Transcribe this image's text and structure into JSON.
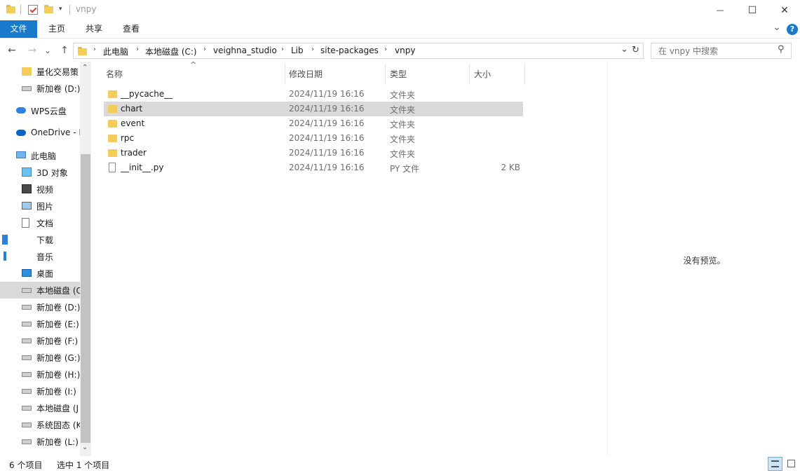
{
  "window": {
    "title": "vnpy",
    "minimize_glyph": "—",
    "maximize_glyph": "☐",
    "close_glyph": "✕"
  },
  "ribbon": {
    "tabs": [
      {
        "label": "文件"
      },
      {
        "label": "主页"
      },
      {
        "label": "共享"
      },
      {
        "label": "查看"
      }
    ],
    "expand_glyph": "⌄",
    "help_glyph": "?"
  },
  "nav": {
    "back_glyph": "←",
    "forward_glyph": "→",
    "recent_glyph": "⌄",
    "up_glyph": "↑",
    "breadcrumbs": [
      "此电脑",
      "本地磁盘 (C:)",
      "veighna_studio",
      "Lib",
      "site-packages",
      "vnpy"
    ],
    "crumb_separator": "›",
    "dropdown_glyph": "⌄",
    "refresh_glyph": "↻",
    "search_placeholder": "在 vnpy 中搜索",
    "search_glyph": "⚲"
  },
  "sidebar": {
    "items": [
      {
        "label": "量化交易策",
        "icon": "folder-icon",
        "indent": 1
      },
      {
        "label": "新加卷 (D:)",
        "icon": "drive-icon",
        "indent": 1
      },
      {
        "label": "WPS云盘",
        "icon": "cloud-icon",
        "indent": 0
      },
      {
        "label": "OneDrive - I",
        "icon": "onedrive-icon",
        "indent": 0
      },
      {
        "label": "此电脑",
        "icon": "computer-icon",
        "indent": 0
      },
      {
        "label": "3D 对象",
        "icon": "cube-icon",
        "indent": 1
      },
      {
        "label": "视频",
        "icon": "video-icon",
        "indent": 1
      },
      {
        "label": "图片",
        "icon": "picture-icon",
        "indent": 1
      },
      {
        "label": "文档",
        "icon": "document-icon",
        "indent": 1
      },
      {
        "label": "下载",
        "icon": "download-icon",
        "indent": 1
      },
      {
        "label": "音乐",
        "icon": "music-icon",
        "indent": 1
      },
      {
        "label": "桌面",
        "icon": "desktop-icon",
        "indent": 1
      },
      {
        "label": "本地磁盘 (C",
        "icon": "windows-drive-icon",
        "indent": 1,
        "selected": true
      },
      {
        "label": "新加卷 (D:)",
        "icon": "drive-icon",
        "indent": 1
      },
      {
        "label": "新加卷 (E:)",
        "icon": "drive-icon",
        "indent": 1
      },
      {
        "label": "新加卷 (F:)",
        "icon": "drive-icon",
        "indent": 1
      },
      {
        "label": "新加卷 (G:)",
        "icon": "drive-icon",
        "indent": 1
      },
      {
        "label": "新加卷 (H:)",
        "icon": "drive-icon",
        "indent": 1
      },
      {
        "label": "新加卷 (I:)",
        "icon": "drive-icon",
        "indent": 1
      },
      {
        "label": "本地磁盘 (J",
        "icon": "drive-icon",
        "indent": 1
      },
      {
        "label": "系统固态 (K",
        "icon": "locked-drive-icon",
        "indent": 1
      },
      {
        "label": "新加卷 (L:)",
        "icon": "drive-icon",
        "indent": 1
      }
    ],
    "scroll_up_glyph": "⌃",
    "scroll_down_glyph": "⌄"
  },
  "filelist": {
    "columns": {
      "name": "名称",
      "date": "修改日期",
      "type": "类型",
      "size": "大小"
    },
    "sort_glyph": "^",
    "rows": [
      {
        "name": "__pycache__",
        "date": "2024/11/19 16:16",
        "type": "文件夹",
        "size": "",
        "icon": "folder-icon"
      },
      {
        "name": "chart",
        "date": "2024/11/19 16:16",
        "type": "文件夹",
        "size": "",
        "icon": "folder-icon",
        "selected": true
      },
      {
        "name": "event",
        "date": "2024/11/19 16:16",
        "type": "文件夹",
        "size": "",
        "icon": "folder-icon"
      },
      {
        "name": "rpc",
        "date": "2024/11/19 16:16",
        "type": "文件夹",
        "size": "",
        "icon": "folder-icon"
      },
      {
        "name": "trader",
        "date": "2024/11/19 16:16",
        "type": "文件夹",
        "size": "",
        "icon": "folder-icon"
      },
      {
        "name": "__init__.py",
        "date": "2024/11/19 16:16",
        "type": "PY 文件",
        "size": "2 KB",
        "icon": "file-icon"
      }
    ]
  },
  "preview": {
    "message": "没有预览。"
  },
  "status": {
    "count": "6 个项目",
    "selected": "选中 1 个项目"
  },
  "colors": {
    "accent": "#1979ca",
    "folder": "#f4cc5a",
    "selection": "#d9d9d9"
  }
}
